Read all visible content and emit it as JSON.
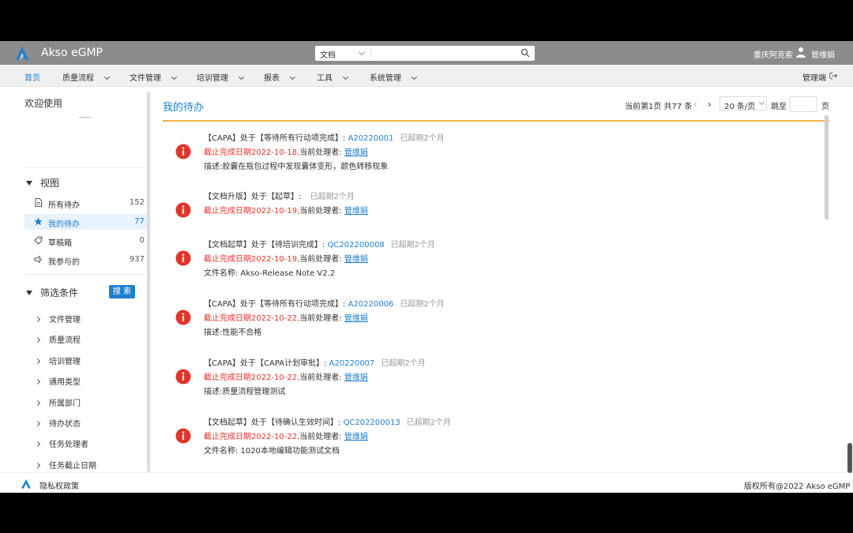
{
  "app": {
    "title": "Akso eGMP",
    "tenant": "重庆阿克索",
    "username": "管维娟",
    "admin_label": "管理端"
  },
  "search": {
    "type_value": "文档",
    "placeholder": ""
  },
  "nav": {
    "items": [
      {
        "label": "首页"
      },
      {
        "label": "质量流程"
      },
      {
        "label": "文件管理"
      },
      {
        "label": "培训管理"
      },
      {
        "label": "报表"
      },
      {
        "label": "工具"
      },
      {
        "label": "系统管理"
      }
    ]
  },
  "sidebar": {
    "welcome": "欢迎使用",
    "view_title": "视图",
    "views": [
      {
        "label": "所有待办",
        "count": "152",
        "icon": "document-icon"
      },
      {
        "label": "我的待办",
        "count": "77",
        "icon": "star-icon"
      },
      {
        "label": "草稿箱",
        "count": "0",
        "icon": "tag-icon"
      },
      {
        "label": "我参与的",
        "count": "937",
        "icon": "speaker-icon"
      }
    ],
    "filter_title": "筛选条件",
    "search_button": "搜 索",
    "filters": [
      {
        "label": "文件管理"
      },
      {
        "label": "质量流程"
      },
      {
        "label": "培训管理"
      },
      {
        "label": "通用类型"
      },
      {
        "label": "所属部门"
      },
      {
        "label": "待办状态"
      },
      {
        "label": "任务处理者"
      },
      {
        "label": "任务截止日期"
      }
    ]
  },
  "main": {
    "title": "我的待办",
    "pager": {
      "info": "当前第1页 共77 条",
      "prev": "‹",
      "next": "›",
      "page_size": "20 条/页",
      "goto_label": "跳至",
      "goto_value": "",
      "unit": "页"
    },
    "tasks": [
      {
        "prefix": "【CAPA】处于【等待所有行动项完成】: ",
        "id": "A20220001",
        "overdue": "已超期2个月",
        "deadline": "截止完成日期2022-10-18,",
        "handler_label": "当前处理者: ",
        "handler": "管维娟",
        "detail": "描述:胶囊在瓶包过程中发现囊体变形，颜色转移现象"
      },
      {
        "prefix": "【文档升版】处于【起草】: ",
        "id": "",
        "overdue": "已超期2个月",
        "deadline": "截止完成日期2022-10-19,",
        "handler_label": "当前处理者: ",
        "handler": "管维娟",
        "detail": ""
      },
      {
        "prefix": "【文档起草】处于【待培训完成】: ",
        "id": "QC202200008",
        "overdue": "已超期2个月",
        "deadline": "截止完成日期2022-10-19,",
        "handler_label": "当前处理者: ",
        "handler": "管维娟",
        "detail": "文件名称: Akso-Release Note V2.2"
      },
      {
        "prefix": "【CAPA】处于【等待所有行动项完成】: ",
        "id": "A20220006",
        "overdue": "已超期2个月",
        "deadline": "截止完成日期2022-10-22,",
        "handler_label": "当前处理者: ",
        "handler": "管维娟",
        "detail": "描述:性能不合格"
      },
      {
        "prefix": "【CAPA】处于【CAPA计划审批】: ",
        "id": "A20220007",
        "overdue": "已超期2个月",
        "deadline": "截止完成日期2022-10-22,",
        "handler_label": "当前处理者: ",
        "handler": "管维娟",
        "detail": "描述:质量流程管理测试"
      },
      {
        "prefix": "【文档起草】处于【待确认生效时间】: ",
        "id": "QC202200013",
        "overdue": "已超期2个月",
        "deadline": "截止完成日期2022-10-22,",
        "handler_label": "当前处理者: ",
        "handler": "管维娟",
        "detail": "文件名称: 1020本地编辑功能测试文档"
      }
    ]
  },
  "footer": {
    "privacy": "隐私权政策",
    "copyright": "版权所有@2022 Akso eGMP"
  },
  "colors": {
    "accent": "#1e7fd0",
    "alert": "#e0352b",
    "topbar": "#8c8c8c",
    "divider": "#f1b24c"
  }
}
